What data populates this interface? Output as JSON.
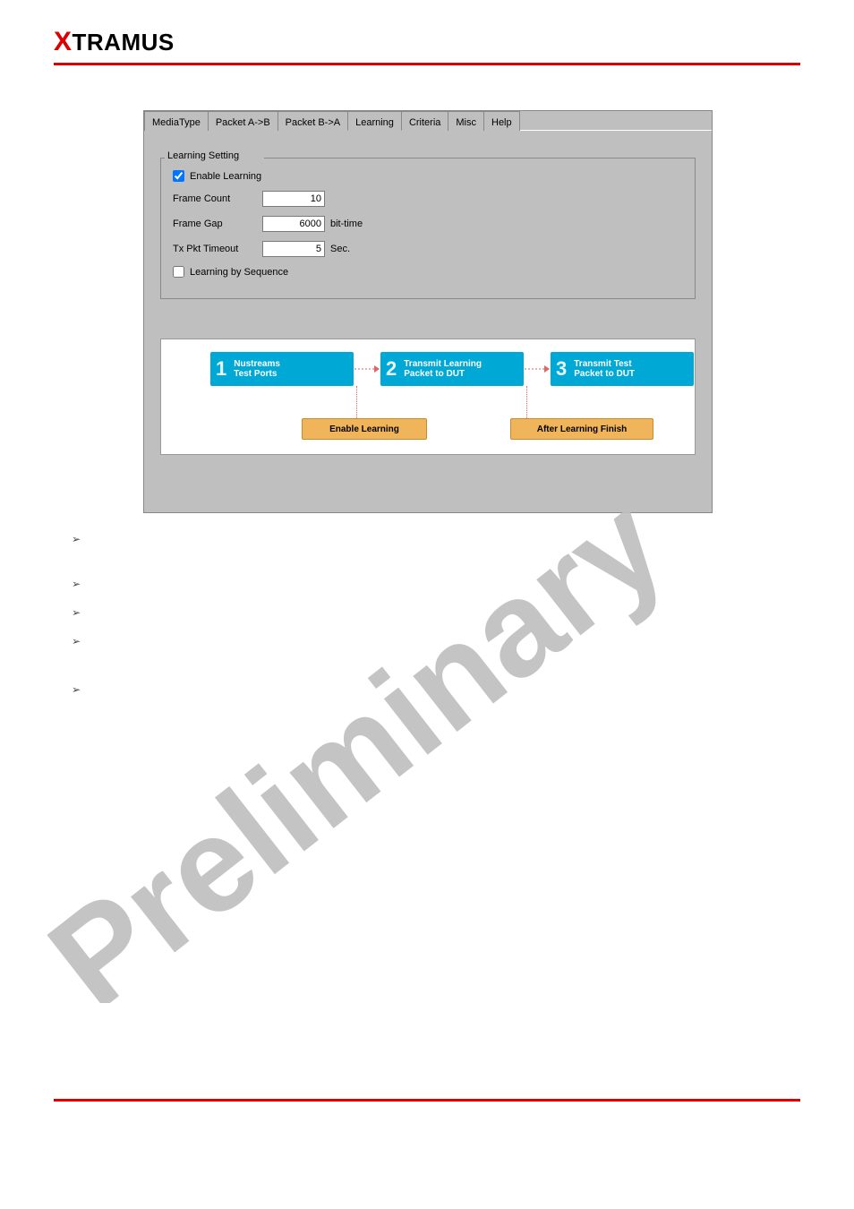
{
  "header": {
    "logo_prefix": "X",
    "logo_rest": "TRAMUS"
  },
  "tabs": {
    "items": [
      {
        "label": "MediaType"
      },
      {
        "label": "Packet A->B"
      },
      {
        "label": "Packet B->A"
      },
      {
        "label": "Learning"
      },
      {
        "label": "Criteria"
      },
      {
        "label": "Misc"
      },
      {
        "label": "Help"
      }
    ],
    "active_index": 3
  },
  "learning": {
    "legend": "Learning Setting",
    "enable_label": "Enable Learning",
    "enable_checked": true,
    "frame_count_label": "Frame Count",
    "frame_count_value": "10",
    "frame_gap_label": "Frame Gap",
    "frame_gap_value": "6000",
    "frame_gap_unit": "bit-time",
    "tx_timeout_label": "Tx Pkt Timeout",
    "tx_timeout_value": "5",
    "tx_timeout_unit": "Sec.",
    "by_seq_label": "Learning by Sequence",
    "by_seq_checked": false
  },
  "flow": {
    "step1_line1": "Nustreams",
    "step1_line2": "Test Ports",
    "step2_line1": "Transmit Learning",
    "step2_line2": "Packet to DUT",
    "step3_line1": "Transmit Test",
    "step3_line2": "Packet to DUT",
    "badge1": "Enable Learning",
    "badge2": "After Learning Finish"
  },
  "watermark_text": "Preliminary"
}
